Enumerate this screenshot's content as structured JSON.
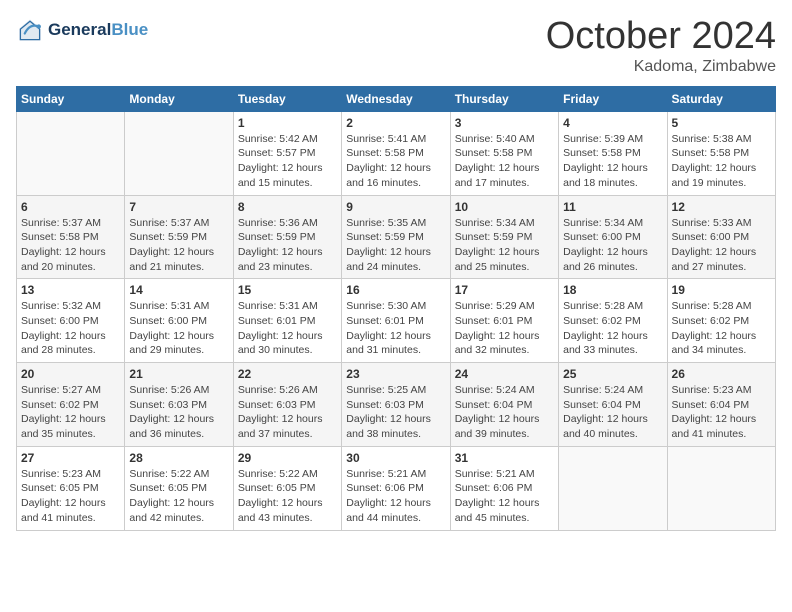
{
  "header": {
    "logo_line1": "General",
    "logo_line2": "Blue",
    "month": "October 2024",
    "location": "Kadoma, Zimbabwe"
  },
  "weekdays": [
    "Sunday",
    "Monday",
    "Tuesday",
    "Wednesday",
    "Thursday",
    "Friday",
    "Saturday"
  ],
  "weeks": [
    [
      {
        "day": "",
        "info": ""
      },
      {
        "day": "",
        "info": ""
      },
      {
        "day": "1",
        "info": "Sunrise: 5:42 AM\nSunset: 5:57 PM\nDaylight: 12 hours and 15 minutes."
      },
      {
        "day": "2",
        "info": "Sunrise: 5:41 AM\nSunset: 5:58 PM\nDaylight: 12 hours and 16 minutes."
      },
      {
        "day": "3",
        "info": "Sunrise: 5:40 AM\nSunset: 5:58 PM\nDaylight: 12 hours and 17 minutes."
      },
      {
        "day": "4",
        "info": "Sunrise: 5:39 AM\nSunset: 5:58 PM\nDaylight: 12 hours and 18 minutes."
      },
      {
        "day": "5",
        "info": "Sunrise: 5:38 AM\nSunset: 5:58 PM\nDaylight: 12 hours and 19 minutes."
      }
    ],
    [
      {
        "day": "6",
        "info": "Sunrise: 5:37 AM\nSunset: 5:58 PM\nDaylight: 12 hours and 20 minutes."
      },
      {
        "day": "7",
        "info": "Sunrise: 5:37 AM\nSunset: 5:59 PM\nDaylight: 12 hours and 21 minutes."
      },
      {
        "day": "8",
        "info": "Sunrise: 5:36 AM\nSunset: 5:59 PM\nDaylight: 12 hours and 23 minutes."
      },
      {
        "day": "9",
        "info": "Sunrise: 5:35 AM\nSunset: 5:59 PM\nDaylight: 12 hours and 24 minutes."
      },
      {
        "day": "10",
        "info": "Sunrise: 5:34 AM\nSunset: 5:59 PM\nDaylight: 12 hours and 25 minutes."
      },
      {
        "day": "11",
        "info": "Sunrise: 5:34 AM\nSunset: 6:00 PM\nDaylight: 12 hours and 26 minutes."
      },
      {
        "day": "12",
        "info": "Sunrise: 5:33 AM\nSunset: 6:00 PM\nDaylight: 12 hours and 27 minutes."
      }
    ],
    [
      {
        "day": "13",
        "info": "Sunrise: 5:32 AM\nSunset: 6:00 PM\nDaylight: 12 hours and 28 minutes."
      },
      {
        "day": "14",
        "info": "Sunrise: 5:31 AM\nSunset: 6:00 PM\nDaylight: 12 hours and 29 minutes."
      },
      {
        "day": "15",
        "info": "Sunrise: 5:31 AM\nSunset: 6:01 PM\nDaylight: 12 hours and 30 minutes."
      },
      {
        "day": "16",
        "info": "Sunrise: 5:30 AM\nSunset: 6:01 PM\nDaylight: 12 hours and 31 minutes."
      },
      {
        "day": "17",
        "info": "Sunrise: 5:29 AM\nSunset: 6:01 PM\nDaylight: 12 hours and 32 minutes."
      },
      {
        "day": "18",
        "info": "Sunrise: 5:28 AM\nSunset: 6:02 PM\nDaylight: 12 hours and 33 minutes."
      },
      {
        "day": "19",
        "info": "Sunrise: 5:28 AM\nSunset: 6:02 PM\nDaylight: 12 hours and 34 minutes."
      }
    ],
    [
      {
        "day": "20",
        "info": "Sunrise: 5:27 AM\nSunset: 6:02 PM\nDaylight: 12 hours and 35 minutes."
      },
      {
        "day": "21",
        "info": "Sunrise: 5:26 AM\nSunset: 6:03 PM\nDaylight: 12 hours and 36 minutes."
      },
      {
        "day": "22",
        "info": "Sunrise: 5:26 AM\nSunset: 6:03 PM\nDaylight: 12 hours and 37 minutes."
      },
      {
        "day": "23",
        "info": "Sunrise: 5:25 AM\nSunset: 6:03 PM\nDaylight: 12 hours and 38 minutes."
      },
      {
        "day": "24",
        "info": "Sunrise: 5:24 AM\nSunset: 6:04 PM\nDaylight: 12 hours and 39 minutes."
      },
      {
        "day": "25",
        "info": "Sunrise: 5:24 AM\nSunset: 6:04 PM\nDaylight: 12 hours and 40 minutes."
      },
      {
        "day": "26",
        "info": "Sunrise: 5:23 AM\nSunset: 6:04 PM\nDaylight: 12 hours and 41 minutes."
      }
    ],
    [
      {
        "day": "27",
        "info": "Sunrise: 5:23 AM\nSunset: 6:05 PM\nDaylight: 12 hours and 41 minutes."
      },
      {
        "day": "28",
        "info": "Sunrise: 5:22 AM\nSunset: 6:05 PM\nDaylight: 12 hours and 42 minutes."
      },
      {
        "day": "29",
        "info": "Sunrise: 5:22 AM\nSunset: 6:05 PM\nDaylight: 12 hours and 43 minutes."
      },
      {
        "day": "30",
        "info": "Sunrise: 5:21 AM\nSunset: 6:06 PM\nDaylight: 12 hours and 44 minutes."
      },
      {
        "day": "31",
        "info": "Sunrise: 5:21 AM\nSunset: 6:06 PM\nDaylight: 12 hours and 45 minutes."
      },
      {
        "day": "",
        "info": ""
      },
      {
        "day": "",
        "info": ""
      }
    ]
  ]
}
